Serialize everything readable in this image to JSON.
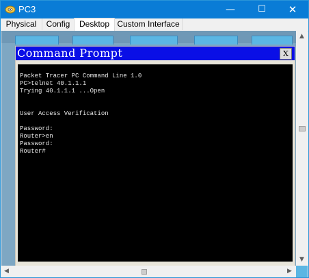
{
  "window": {
    "title": "PC3",
    "minimize_glyph": "—",
    "maximize_glyph": "☐",
    "close_glyph": "✕",
    "accent_color": "#0a7cd6"
  },
  "tabs": [
    {
      "label": "Physical"
    },
    {
      "label": "Config"
    },
    {
      "label": "Desktop",
      "active": true
    },
    {
      "label": "Custom Interface"
    }
  ],
  "command_prompt": {
    "title": "Command Prompt",
    "close_label": "X",
    "title_color": "#0a0fe6",
    "lines": [
      "Packet Tracer PC Command Line 1.0",
      "PC>telnet 40.1.1.1",
      "Trying 40.1.1.1 ...Open",
      "",
      "",
      "User Access Verification",
      "",
      "Password:",
      "Router>en",
      "Password:",
      "Router#"
    ]
  },
  "scrollbars": {
    "up_glyph": "▲",
    "down_glyph": "▼",
    "left_glyph": "◀",
    "right_glyph": "▶"
  }
}
